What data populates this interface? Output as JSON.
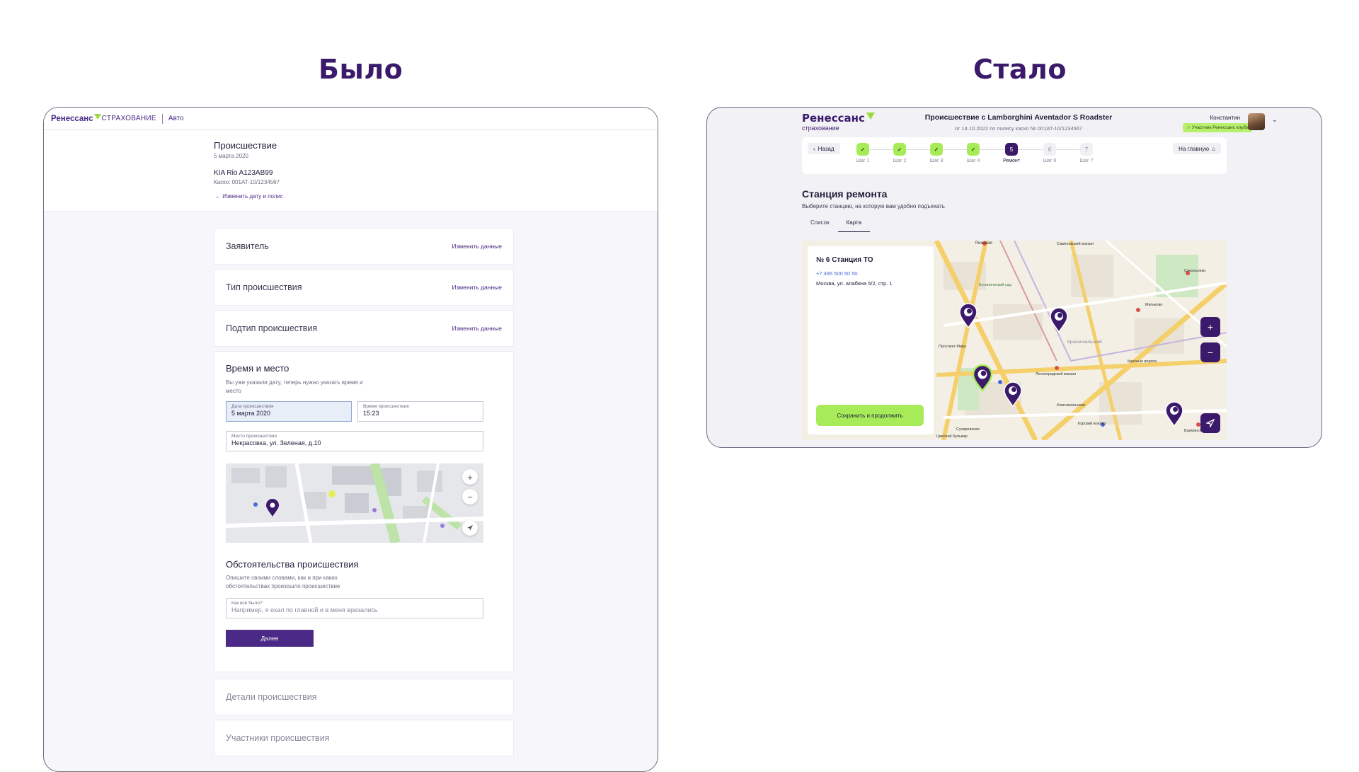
{
  "headings": {
    "before": "Было",
    "after": "Стало"
  },
  "before": {
    "header": {
      "logo": "Ренессанс",
      "logo_sub": "СТРАХОВАНИЕ",
      "section": "Авто"
    },
    "incident": {
      "title": "Происшествие",
      "date": "5 марта 2020",
      "car": "KIA Rio A123AB99",
      "kasko": "Каско: 001AT-10/1234567",
      "change_link": "← Изменить дату и полис"
    },
    "sections": [
      {
        "label": "Заявитель",
        "edit": "Изменить данные"
      },
      {
        "label": "Тип происшествия",
        "edit": "Изменить данные"
      },
      {
        "label": "Подтип происшествия",
        "edit": "Изменить данные"
      }
    ],
    "time_place": {
      "title": "Время и место",
      "desc": "Вы уже указали дату, теперь нужно указать время и место",
      "date_label": "Дата происшествия",
      "date_value": "5 марта 2020",
      "time_label": "Время происшествия",
      "time_value": "15:23",
      "place_label": "Место происшествия",
      "place_value": "Некрасовка, ул. Зеленая, д.10",
      "circ_title": "Обстоятельства происшествия",
      "circ_desc": "Опишите своими словами, как и при каких обстоятельствах произошло происшествие",
      "how_label": "Как всё было?",
      "how_placeholder": "Например, я ехал по главной и в меня врезались",
      "next_button": "Далее"
    },
    "collapsed": [
      "Детали происшествия",
      "Участники происшествия"
    ],
    "map_plus": "+",
    "map_minus": "−"
  },
  "after": {
    "logo": {
      "line1": "Ренессанс",
      "line2": "страхование"
    },
    "title": "Происшествие с Lamborghini Aventador S Roadster",
    "subtitle": "от 14.10.2022 по полису каско № 001AT-10/1234567",
    "user": "Константин",
    "club_badge": "Участник Ренессанс клуба",
    "back": "Назад",
    "home": "На главную",
    "steps": [
      {
        "num": "✓",
        "label": "Шаг 1",
        "state": "done"
      },
      {
        "num": "✓",
        "label": "Шаг 2",
        "state": "done"
      },
      {
        "num": "✓",
        "label": "Шаг 3",
        "state": "done"
      },
      {
        "num": "✓",
        "label": "Шаг 4",
        "state": "done"
      },
      {
        "num": "5",
        "label": "Ремонт",
        "state": "current"
      },
      {
        "num": "6",
        "label": "Шаг 6",
        "state": "todo"
      },
      {
        "num": "7",
        "label": "Шаг 7",
        "state": "todo"
      }
    ],
    "page_title": "Станция ремонта",
    "page_desc": "Выберите станцию, на которую вам удобно подъехать",
    "tabs": [
      "Список",
      "Карта"
    ],
    "active_tab": "Карта",
    "station": {
      "name": "№ 6 Станция ТО",
      "phone": "+7 495 500 50 50",
      "address": "Москва, ул. алабяна 5/2, стр. 1"
    },
    "save_button": "Сохранить и продолжить",
    "zoom_in": "+",
    "zoom_out": "−",
    "map_labels": [
      "Рижская",
      "Красносельский",
      "Ленинградский вокзал",
      "Комсомольская",
      "Проспект Мира",
      "Сокольники",
      "Митьково",
      "Курский вокзал",
      "Бауманская",
      "Сухаревская",
      "Красные ворота",
      "Ботанический сад",
      "Савёловский вокзал",
      "Цветной бульвар"
    ],
    "colors": {
      "brand": "#3b1a6b",
      "accent": "#a7ec58"
    }
  }
}
